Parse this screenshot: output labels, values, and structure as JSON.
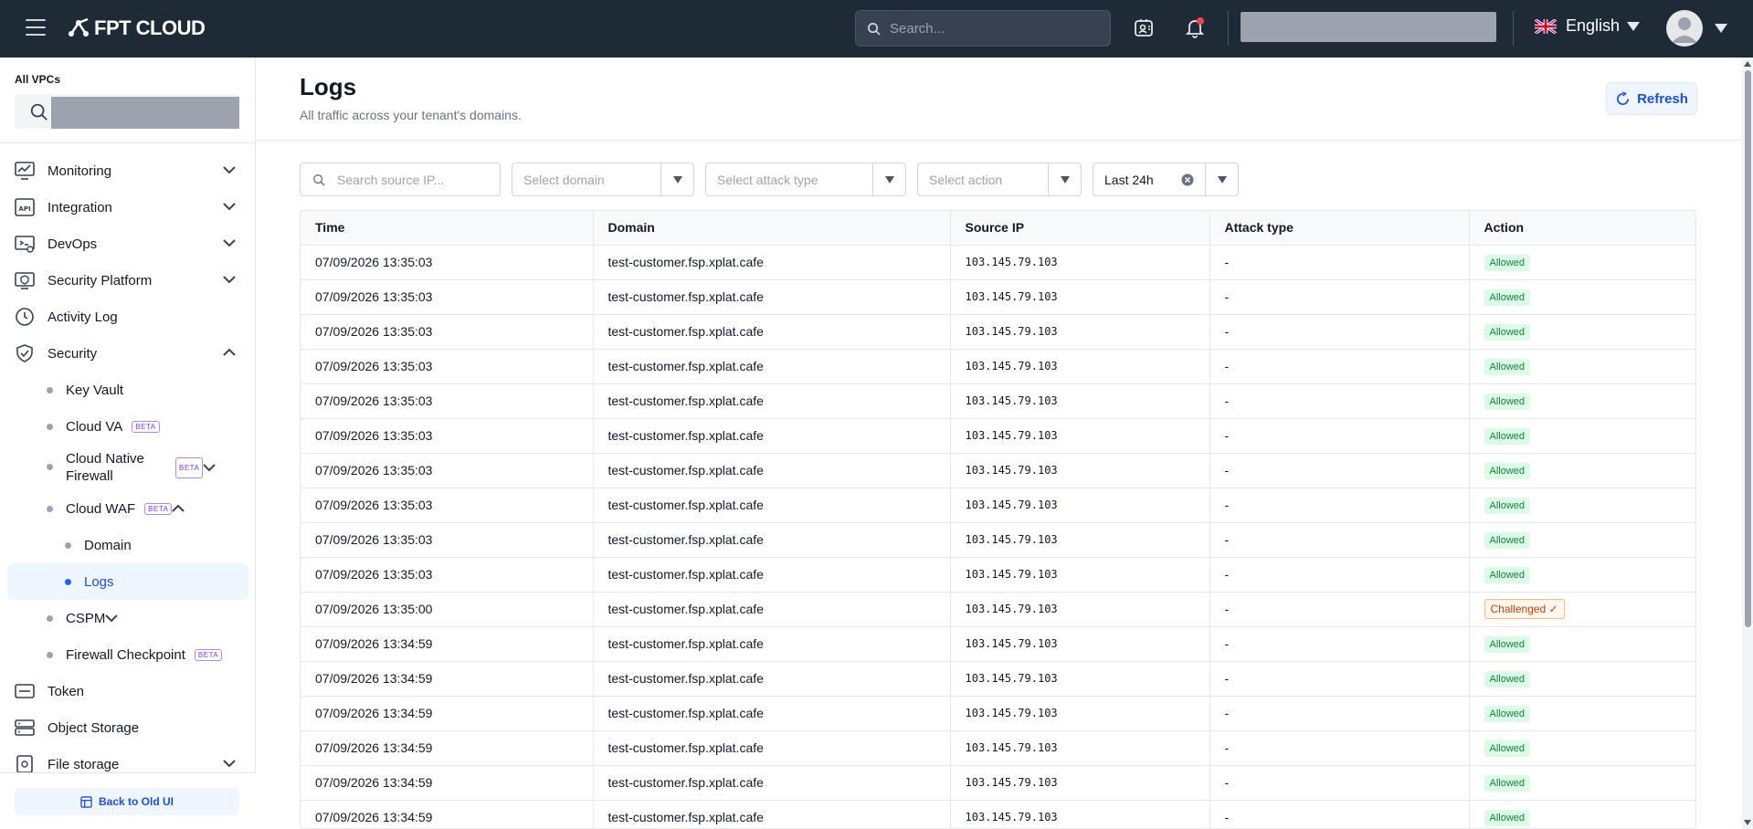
{
  "brand": {
    "name": "FPT CLOUD"
  },
  "topbar": {
    "search_placeholder": "Search...",
    "language": "English"
  },
  "sidebar": {
    "vpc_label": "All VPCs",
    "items": [
      {
        "label": "Monitoring",
        "icon": "monitor-chart-icon",
        "expanded": false
      },
      {
        "label": "Integration",
        "icon": "api-icon",
        "expanded": false
      },
      {
        "label": "DevOps",
        "icon": "devops-icon",
        "expanded": false
      },
      {
        "label": "Security Platform",
        "icon": "security-platform-icon",
        "expanded": false
      },
      {
        "label": "Activity Log",
        "icon": "clock-icon"
      },
      {
        "label": "Security",
        "icon": "shield-icon",
        "expanded": true
      }
    ],
    "security_sub": [
      {
        "label": "Key Vault"
      },
      {
        "label": "Cloud VA",
        "badge": "BETA"
      },
      {
        "label": "Cloud Native Firewall",
        "badge": "BETA"
      },
      {
        "label": "Cloud WAF",
        "badge": "BETA"
      }
    ],
    "waf_sub": [
      {
        "label": "Domain"
      },
      {
        "label": "Logs"
      }
    ],
    "security_sub_after": [
      {
        "label": "CSPM"
      },
      {
        "label": "Firewall Checkpoint",
        "badge": "BETA"
      }
    ],
    "items_after": [
      {
        "label": "Token",
        "icon": "token-icon"
      },
      {
        "label": "Object Storage",
        "icon": "storage-icon"
      },
      {
        "label": "File storage",
        "icon": "file-storage-icon"
      }
    ],
    "back_label": "Back to Old UI"
  },
  "page": {
    "title": "Logs",
    "subtitle": "All traffic across your tenant's domains.",
    "refresh_label": "Refresh"
  },
  "filters": {
    "source_ip_placeholder": "Search source IP...",
    "domain_placeholder": "Select domain",
    "attack_type_placeholder": "Select attack type",
    "action_placeholder": "Select action",
    "time_range": "Last 24h"
  },
  "table": {
    "headers": [
      "Time",
      "Domain",
      "Source IP",
      "Attack type",
      "Action"
    ],
    "rows": [
      [
        "07/09/2026 13:35:03",
        "test-customer.fsp.xplat.cafe",
        "103.145.79.103",
        "-",
        "Allowed"
      ],
      [
        "07/09/2026 13:35:03",
        "test-customer.fsp.xplat.cafe",
        "103.145.79.103",
        "-",
        "Allowed"
      ],
      [
        "07/09/2026 13:35:03",
        "test-customer.fsp.xplat.cafe",
        "103.145.79.103",
        "-",
        "Allowed"
      ],
      [
        "07/09/2026 13:35:03",
        "test-customer.fsp.xplat.cafe",
        "103.145.79.103",
        "-",
        "Allowed"
      ],
      [
        "07/09/2026 13:35:03",
        "test-customer.fsp.xplat.cafe",
        "103.145.79.103",
        "-",
        "Allowed"
      ],
      [
        "07/09/2026 13:35:03",
        "test-customer.fsp.xplat.cafe",
        "103.145.79.103",
        "-",
        "Allowed"
      ],
      [
        "07/09/2026 13:35:03",
        "test-customer.fsp.xplat.cafe",
        "103.145.79.103",
        "-",
        "Allowed"
      ],
      [
        "07/09/2026 13:35:03",
        "test-customer.fsp.xplat.cafe",
        "103.145.79.103",
        "-",
        "Allowed"
      ],
      [
        "07/09/2026 13:35:03",
        "test-customer.fsp.xplat.cafe",
        "103.145.79.103",
        "-",
        "Allowed"
      ],
      [
        "07/09/2026 13:35:03",
        "test-customer.fsp.xplat.cafe",
        "103.145.79.103",
        "-",
        "Allowed"
      ],
      [
        "07/09/2026 13:35:00",
        "test-customer.fsp.xplat.cafe",
        "103.145.79.103",
        "-",
        "Challenged ✓"
      ],
      [
        "07/09/2026 13:34:59",
        "test-customer.fsp.xplat.cafe",
        "103.145.79.103",
        "-",
        "Allowed"
      ],
      [
        "07/09/2026 13:34:59",
        "test-customer.fsp.xplat.cafe",
        "103.145.79.103",
        "-",
        "Allowed"
      ],
      [
        "07/09/2026 13:34:59",
        "test-customer.fsp.xplat.cafe",
        "103.145.79.103",
        "-",
        "Allowed"
      ],
      [
        "07/09/2026 13:34:59",
        "test-customer.fsp.xplat.cafe",
        "103.145.79.103",
        "-",
        "Allowed"
      ],
      [
        "07/09/2026 13:34:59",
        "test-customer.fsp.xplat.cafe",
        "103.145.79.103",
        "-",
        "Allowed"
      ],
      [
        "07/09/2026 13:34:59",
        "test-customer.fsp.xplat.cafe",
        "103.145.79.103",
        "-",
        "Allowed"
      ]
    ]
  },
  "colors": {
    "topbar_bg": "#1f2a37",
    "accent": "#1d4ed8",
    "allowed_bg": "#dcfce7",
    "allowed_text": "#15803d",
    "challenged_text": "#c2410c"
  }
}
